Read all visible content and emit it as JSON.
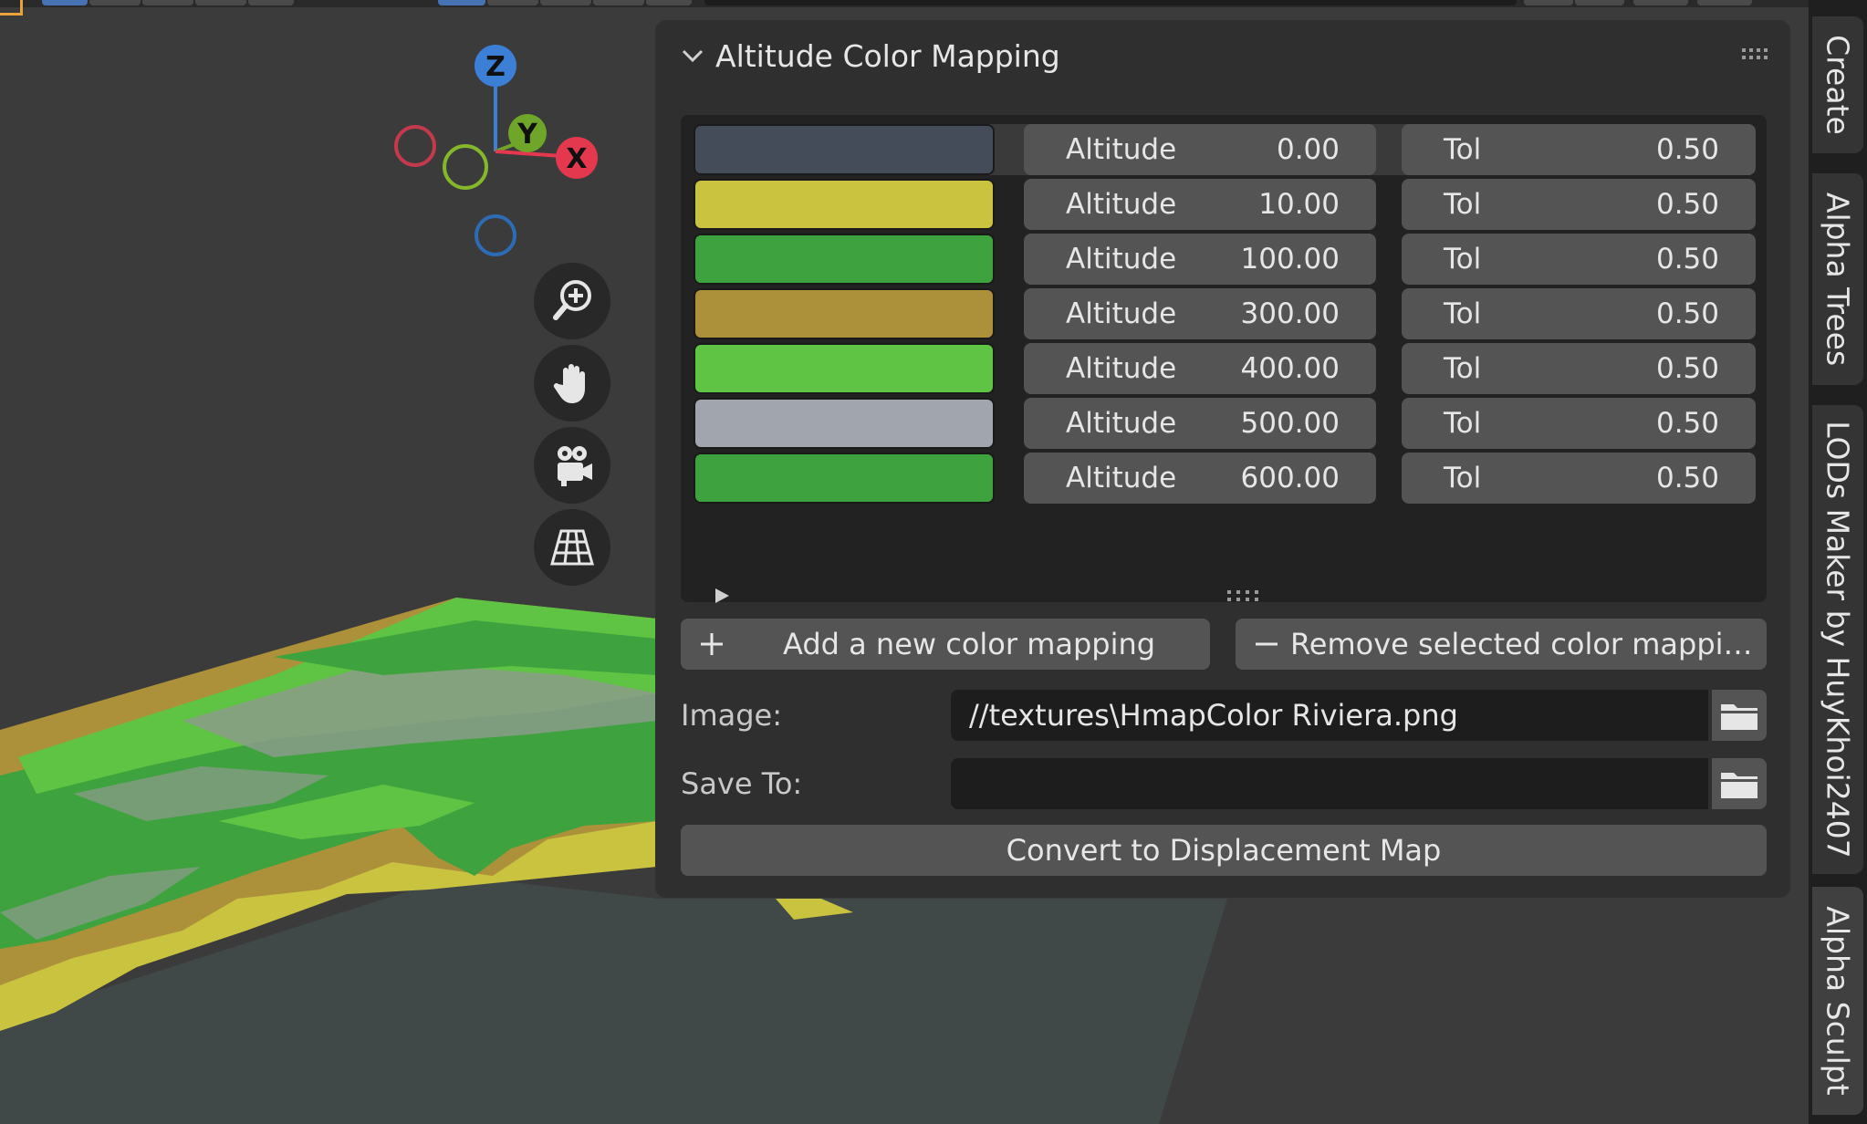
{
  "panel": {
    "title": "Altitude Color Mapping",
    "rows": [
      {
        "color": "#454c59",
        "altitude_label": "Altitude",
        "altitude": "0.00",
        "tol_label": "Tol",
        "tol": "0.50"
      },
      {
        "color": "#c9c340",
        "altitude_label": "Altitude",
        "altitude": "10.00",
        "tol_label": "Tol",
        "tol": "0.50"
      },
      {
        "color": "#3ea33e",
        "altitude_label": "Altitude",
        "altitude": "100.00",
        "tol_label": "Tol",
        "tol": "0.50"
      },
      {
        "color": "#ad903a",
        "altitude_label": "Altitude",
        "altitude": "300.00",
        "tol_label": "Tol",
        "tol": "0.50"
      },
      {
        "color": "#5fc443",
        "altitude_label": "Altitude",
        "altitude": "400.00",
        "tol_label": "Tol",
        "tol": "0.50"
      },
      {
        "color": "#a1a5ae",
        "altitude_label": "Altitude",
        "altitude": "500.00",
        "tol_label": "Tol",
        "tol": "0.50"
      },
      {
        "color": "#3ea33e",
        "altitude_label": "Altitude",
        "altitude": "600.00",
        "tol_label": "Tol",
        "tol": "0.50"
      }
    ],
    "add_label": "Add a new color mapping",
    "remove_label": "Remove selected color mappi…",
    "image_label": "Image:",
    "image_value": "//textures\\HmapColor Riviera.png",
    "saveto_label": "Save To:",
    "saveto_value": "",
    "convert_label": "Convert to Displacement Map"
  },
  "gizmo": {
    "z": "Z",
    "y": "Y",
    "x": "X"
  },
  "tabs": [
    "Create",
    "Alpha Trees",
    "LODs Maker by HuyKhoi2407",
    "Alpha Sculpt"
  ],
  "nav_icons": [
    "zoom-icon",
    "hand-pan-icon",
    "camera-icon",
    "perspective-grid-icon"
  ]
}
